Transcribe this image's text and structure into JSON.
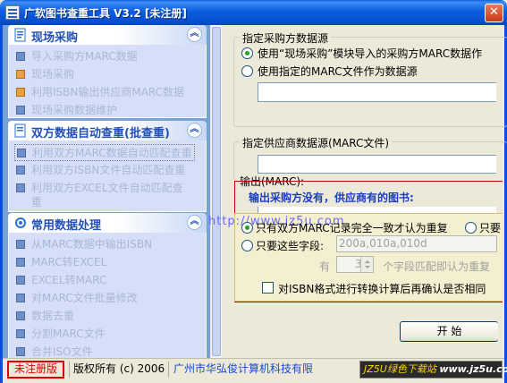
{
  "window": {
    "title": "广软图书查重工具 V3.2 [未注册]",
    "close_glyph": "✕"
  },
  "sidebar": {
    "collapse_glyph": "︽",
    "groups": [
      {
        "title": "现场采购",
        "items": [
          {
            "label": "导入采购方MARC数据",
            "icon": "grid-icon"
          },
          {
            "label": "现场采购",
            "icon": "barcode-01-icon"
          },
          {
            "label": "利用ISBN输出供应商MARC数据",
            "icon": "barcode-01-icon"
          },
          {
            "label": "现场采购数据维护",
            "icon": "grid-icon"
          }
        ]
      },
      {
        "title": "双方数据自动查重(批查重)",
        "items": [
          {
            "label": "利用双方MARC数据自动匹配查重",
            "icon": "grid-icon"
          },
          {
            "label": "利用双方ISBN文件自动匹配查重",
            "icon": "grid-icon"
          },
          {
            "label": "利用双方EXCEL文件自动匹配查",
            "label2": "重",
            "icon": "grid-icon"
          }
        ]
      },
      {
        "title": "常用数据处理",
        "items": [
          {
            "label": "从MARC数据中输出ISBN",
            "icon": "grid-icon"
          },
          {
            "label": "MARC转EXCEL",
            "icon": "grid-icon"
          },
          {
            "label": "EXCEL转MARC",
            "icon": "grid-icon"
          },
          {
            "label": "对MARC文件批量修改",
            "icon": "grid-icon"
          },
          {
            "label": "数据去重",
            "icon": "grid-icon"
          },
          {
            "label": "分割MARC文件",
            "icon": "grid-icon"
          },
          {
            "label": "合并ISO文件",
            "icon": "grid-icon"
          }
        ]
      }
    ]
  },
  "main": {
    "purchaser_source": {
      "title": "指定采购方数据源",
      "option1": "使用“现场采购”模块导入的采购方MARC数据作",
      "option2": "使用指定的MARC文件作为数据源"
    },
    "supplier_source": {
      "title": "指定供应商数据源(MARC文件)"
    },
    "output": {
      "title": "输出(MARC):",
      "headline": "输出采购方没有，供应商有的图书:",
      "watermark_url": "http://www.jz5u.com",
      "match_all": "只有双方MARC记录完全一致才认为重复",
      "match_part": "只要",
      "match_fields_label": "只要这些字段:",
      "fields_value": "200a,010a,010d",
      "have_label": "有",
      "count_value": "3",
      "count_suffix": "个字段匹配即认为重复",
      "isbn_check": "对ISBN格式进行转换计算后再确认是否相同"
    },
    "start_button": "开  始"
  },
  "statusbar": {
    "unregistered": "未注册版",
    "copyright": "版权所有 (c) 2006",
    "company": "广州市华弘俊计算机科技有限",
    "badge_brand": "JZ5U绿色下载站",
    "badge_url": "www.jz5u.com"
  }
}
